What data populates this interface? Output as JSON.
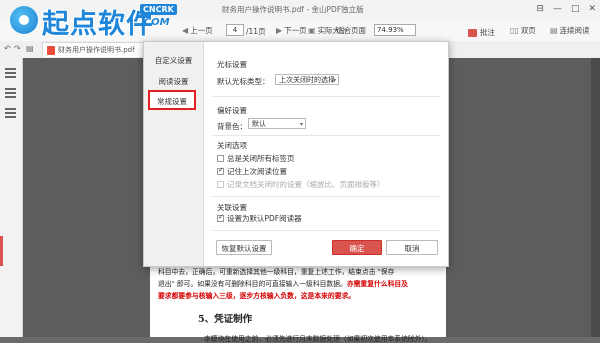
{
  "window": {
    "title": "财务用户操作说明书.pdf - 金山PDF独立版",
    "controls": [
      "⊟",
      "—",
      "□",
      "✕"
    ]
  },
  "logo": {
    "text": "起点软件",
    "badge": "CNCRK",
    "com": ".COM"
  },
  "toolbar": {
    "prev_page": "上一页",
    "page_current": "4",
    "page_total": "/11页",
    "next_page": "下一页",
    "actual_size": "实际大小",
    "fit_page": "适合页面",
    "zoom": "74.93%",
    "comment": "批注",
    "double_page": "双页",
    "continuous_read": "连续阅读"
  },
  "tab": {
    "filename": "财务用户操作说明书.pdf",
    "add": "+"
  },
  "document": {
    "line1": "科目中去，正确后，可重新选择其他一级科目，重复上述工作，结束点击 \"保存",
    "line2": "退出\" 即可。如果没有可删除科目的可直接输入一级科目数据。",
    "line2_red": "亦需重复什么科目及",
    "line3_red": "要求都要参与核输入三级，逐步方核输入负数，这是本来的要求。",
    "heading": "5、凭证制作",
    "body": "本模块在使用之前，必须先进行月末数据处理（如果初次使用本系统除外）。"
  },
  "dialog": {
    "nav": {
      "custom": "自定义设置",
      "reading": "阅读设置",
      "general": "常规设置"
    },
    "cursor": {
      "title": "光标设置",
      "default_label": "默认光标类型：",
      "default_value": "上次关闭时的选择"
    },
    "preference": {
      "title": "偏好设置",
      "bg_label": "背景色：",
      "bg_value": "默认"
    },
    "close_options": {
      "title": "关闭选项",
      "opt1": "总是关闭所有标签页",
      "opt1_checked": false,
      "opt2": "记住上次阅读位置",
      "opt2_checked": true,
      "opt3": "记录文档关闭时的设置（缩放比、页面排版等）",
      "opt3_checked": false
    },
    "association": {
      "title": "关联设置",
      "opt1": "设置为默认PDF阅读器",
      "opt1_checked": true
    },
    "buttons": {
      "reset": "恢复默认设置",
      "ok": "确定",
      "cancel": "取消"
    }
  },
  "colors": {
    "accent": "#d9534f",
    "logo_blue": "#1f86d9",
    "highlight_border": "#e02020"
  }
}
